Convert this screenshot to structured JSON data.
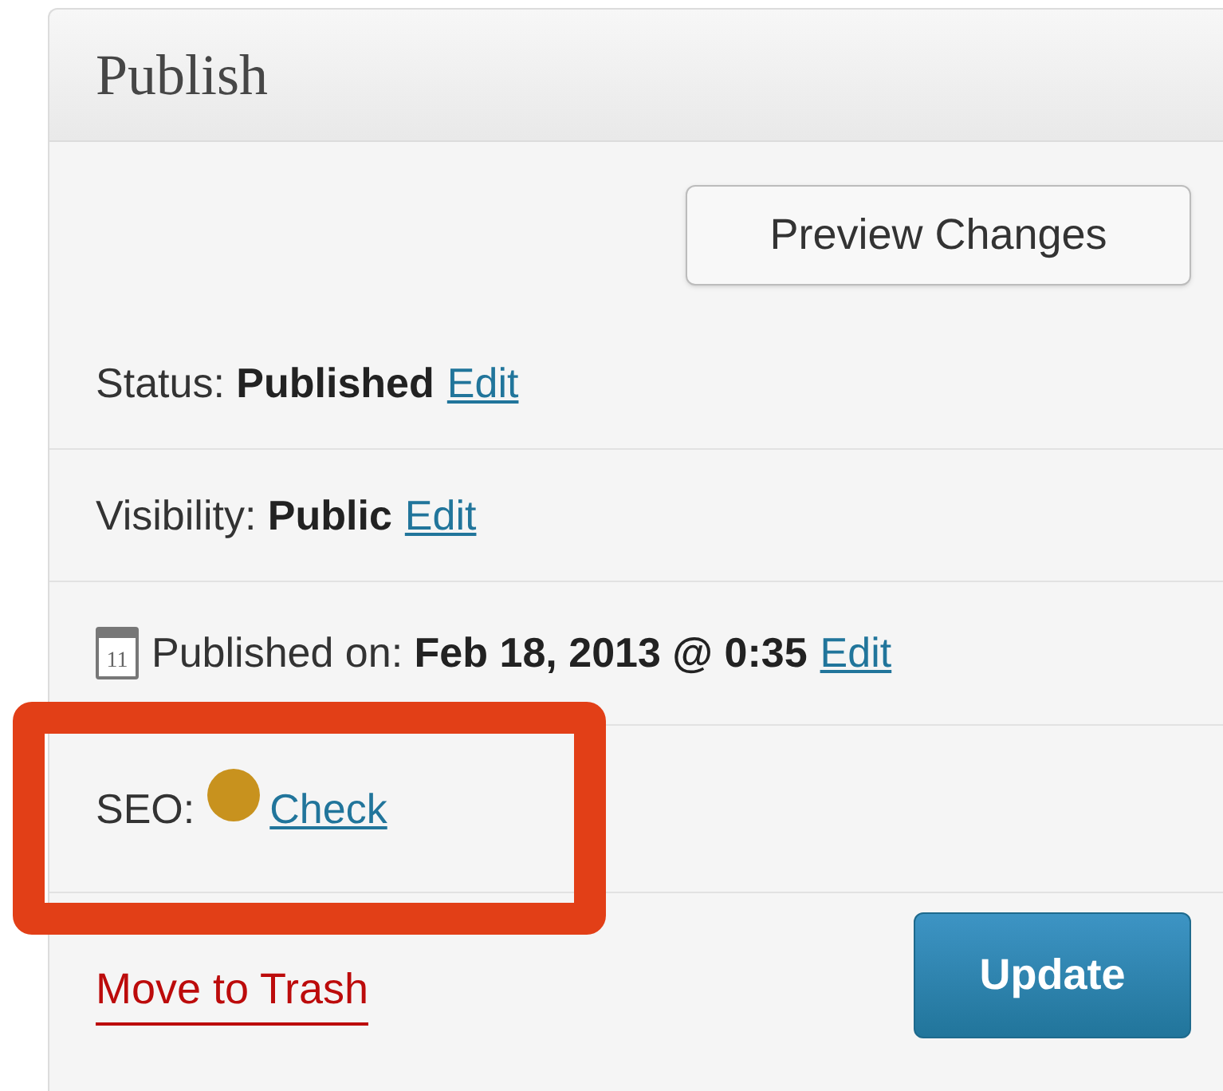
{
  "panel": {
    "title": "Publish"
  },
  "preview_button": "Preview Changes",
  "rows": [
    {
      "kind": "meta",
      "label": "Status:",
      "value": "Published",
      "link": "Edit"
    },
    {
      "kind": "meta",
      "label": "Visibility:",
      "value": "Public",
      "link": "Edit"
    },
    {
      "kind": "date",
      "icon_day": "11",
      "label": "Published on:",
      "value": "Feb 18, 2013 @ 0:35",
      "link": "Edit"
    },
    {
      "kind": "seo",
      "label": "SEO:",
      "color": "#c8921e",
      "link": "Check",
      "highlighted": true
    }
  ],
  "trash_link": "Move to Trash",
  "update_button": "Update"
}
